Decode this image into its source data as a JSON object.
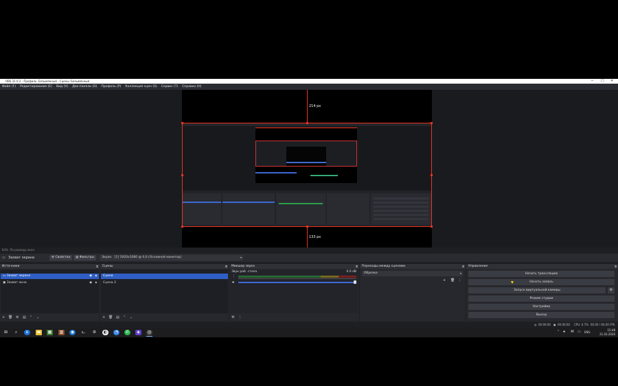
{
  "window": {
    "title": "OBS 31.0.2 - Профиль: Безымянный - Сцены: Безымянный"
  },
  "menu": [
    "Файл (F)",
    "Редактирование (E)",
    "Вид (V)",
    "Док-панели (D)",
    "Профиль (P)",
    "Коллекция сцен (S)",
    "Сервис (T)",
    "Справка (H)"
  ],
  "preview": {
    "top_distance": "214 px",
    "bottom_distance": "133 px"
  },
  "zoom": {
    "label": "83%",
    "fit_label": "По размеру окна"
  },
  "toolbar": {
    "source_name": "Захват экрана",
    "properties": "Свойства",
    "filters": "Фильтры",
    "display_label": "Экран",
    "display_value": "[1] 1920x1080 @ 0,0 (Основной монитор)"
  },
  "sources": {
    "title": "Источники",
    "items": [
      "Захват экрана",
      "Захват окна"
    ]
  },
  "scenes": {
    "title": "Сцены",
    "items": [
      "Сцена",
      "Сцена 2"
    ]
  },
  "mixer": {
    "title": "Микшер звука",
    "channel": "Звук раб. стола",
    "level": "0.0 dB"
  },
  "transitions": {
    "title": "Переходы между сценами",
    "selected": "Обрезка"
  },
  "controls": {
    "title": "Управление",
    "buttons": [
      "Начать трансляцию",
      "Начать запись",
      "Запуск виртуальной камеры",
      "Режим студии",
      "Настройки",
      "Выход"
    ]
  },
  "status": {
    "stream_time": "00:00:00",
    "rec_time": "00:00:00",
    "cpu": "CPU: 0.7%",
    "fps": "60.00 / 60.00 FPS"
  },
  "taskbar": {
    "lang": "ENG",
    "time": "15:48",
    "date": "21.03.2026"
  },
  "colors": {
    "accent": "#2f5ec4",
    "guide": "#e32222",
    "background": "#1e1f23"
  }
}
